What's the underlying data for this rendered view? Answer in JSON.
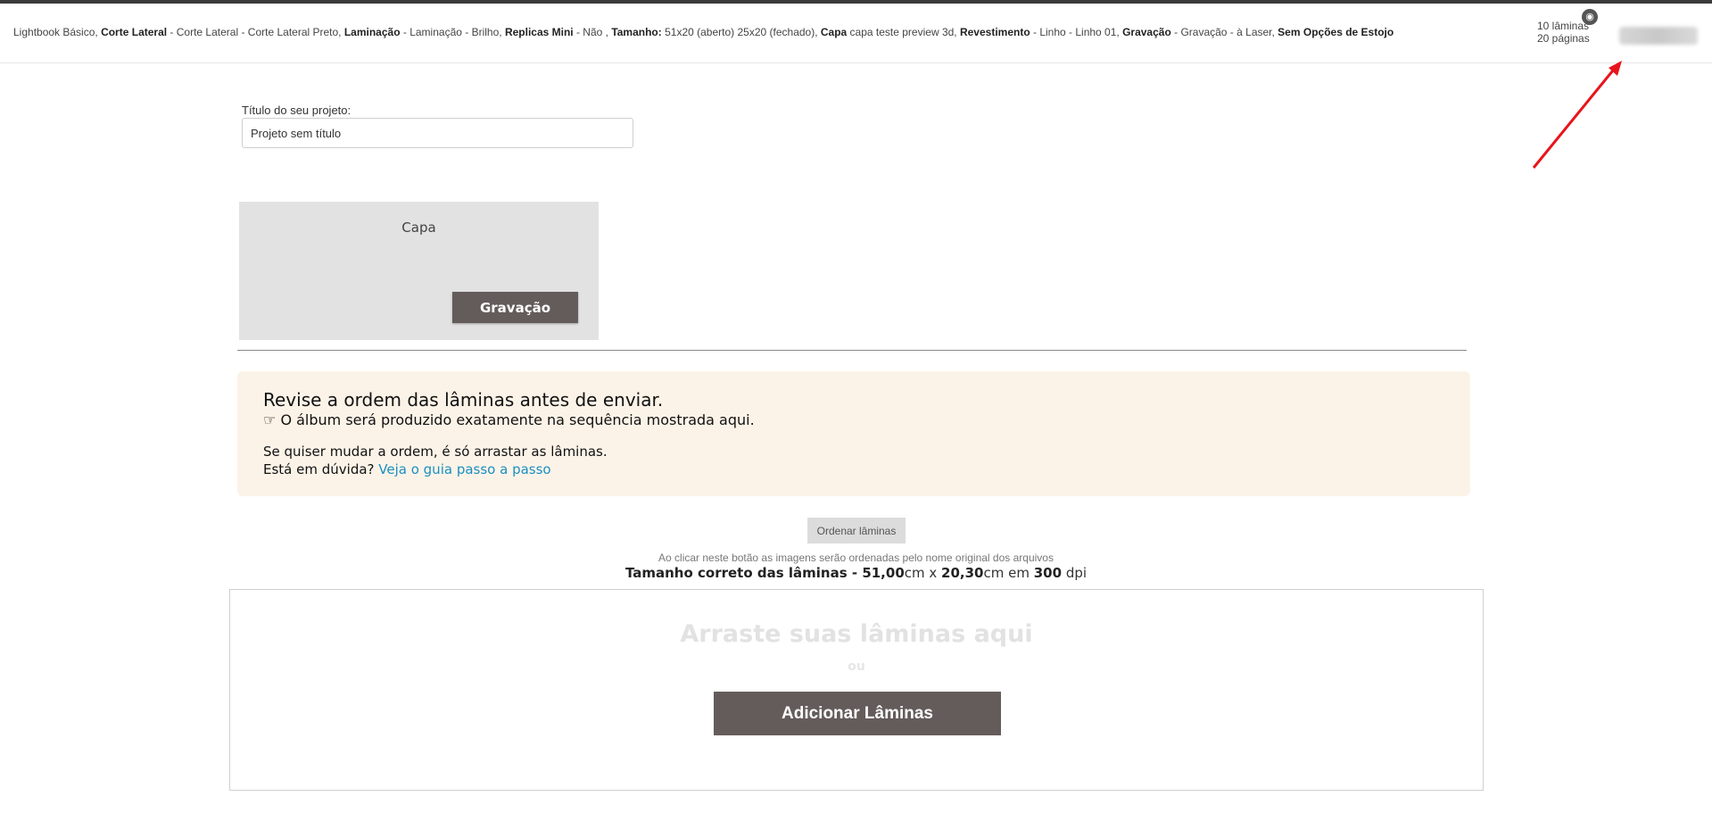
{
  "header": {
    "summary": [
      {
        "text": "Lightbook Básico, ",
        "bold": false
      },
      {
        "text": "Corte Lateral",
        "bold": true
      },
      {
        "text": " - Corte Lateral - Corte Lateral Preto, ",
        "bold": false
      },
      {
        "text": "Laminação",
        "bold": true
      },
      {
        "text": " - Laminação - Brilho, ",
        "bold": false
      },
      {
        "text": "Replicas Mini",
        "bold": true
      },
      {
        "text": " - Não , ",
        "bold": false
      },
      {
        "text": "Tamanho:",
        "bold": true
      },
      {
        "text": " 51x20 (aberto)  25x20 (fechado), ",
        "bold": false
      },
      {
        "text": "Capa",
        "bold": true
      },
      {
        "text": " capa teste preview 3d, ",
        "bold": false
      },
      {
        "text": "Revestimento",
        "bold": true
      },
      {
        "text": " - Linho - Linho 01, ",
        "bold": false
      },
      {
        "text": "Gravação",
        "bold": true
      },
      {
        "text": " - Gravação - à Laser, ",
        "bold": false
      },
      {
        "text": "Sem Opções de Estojo",
        "bold": true
      }
    ],
    "sheets_count": "10 lâminas",
    "pages_count": "20 páginas",
    "eye_icon": "eye-icon"
  },
  "project": {
    "title_label": "Título do seu projeto:",
    "title_value": "Projeto sem título"
  },
  "cover": {
    "label": "Capa",
    "engrave_button": "Gravação"
  },
  "notice": {
    "title": "Revise a ordem das lâminas antes de enviar.",
    "subtitle_icon": "☞",
    "subtitle": "O álbum será produzido exatamente na sequência mostrada aqui.",
    "line1": "Se quiser mudar a ordem, é só arrastar as lâminas.",
    "line2_prefix": "Está em dúvida? ",
    "line2_link": "Veja o guia passo a passo"
  },
  "order": {
    "button": "Ordenar lâminas",
    "hint": "Ao clicar neste botão as imagens serão ordenadas pelo nome original dos arquivos"
  },
  "size_info": {
    "label": "Tamanho correto das lâminas - ",
    "width": "51,00",
    "unit1": "cm x ",
    "height": "20,30",
    "unit2": "cm em ",
    "dpi": "300",
    "dpi_unit": " dpi"
  },
  "dropzone": {
    "title": "Arraste suas lâminas aqui",
    "or": "ou",
    "add_button": "Adicionar Lâminas"
  },
  "colors": {
    "accent_button": "#645c5b",
    "notice_bg": "#fcf3e8",
    "link": "#1a8fc1",
    "arrow": "#e8141b"
  }
}
